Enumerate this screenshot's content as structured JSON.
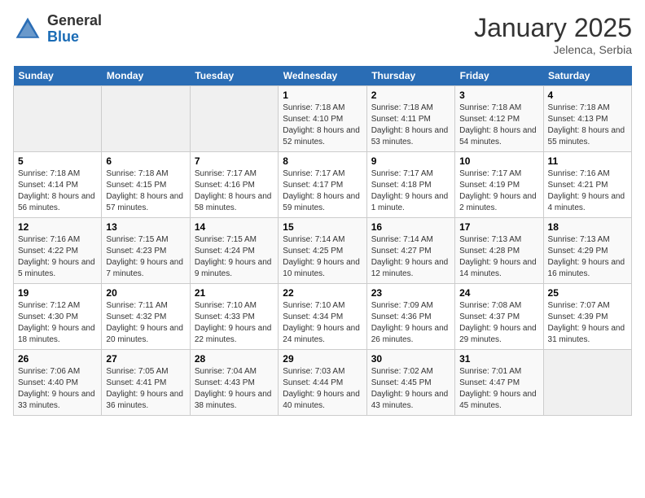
{
  "header": {
    "logo_general": "General",
    "logo_blue": "Blue",
    "month_title": "January 2025",
    "location": "Jelenca, Serbia"
  },
  "weekdays": [
    "Sunday",
    "Monday",
    "Tuesday",
    "Wednesday",
    "Thursday",
    "Friday",
    "Saturday"
  ],
  "rows": [
    [
      {
        "day": "",
        "sunrise": "",
        "sunset": "",
        "daylight": "",
        "empty": true
      },
      {
        "day": "",
        "sunrise": "",
        "sunset": "",
        "daylight": "",
        "empty": true
      },
      {
        "day": "",
        "sunrise": "",
        "sunset": "",
        "daylight": "",
        "empty": true
      },
      {
        "day": "1",
        "sunrise": "Sunrise: 7:18 AM",
        "sunset": "Sunset: 4:10 PM",
        "daylight": "Daylight: 8 hours and 52 minutes."
      },
      {
        "day": "2",
        "sunrise": "Sunrise: 7:18 AM",
        "sunset": "Sunset: 4:11 PM",
        "daylight": "Daylight: 8 hours and 53 minutes."
      },
      {
        "day": "3",
        "sunrise": "Sunrise: 7:18 AM",
        "sunset": "Sunset: 4:12 PM",
        "daylight": "Daylight: 8 hours and 54 minutes."
      },
      {
        "day": "4",
        "sunrise": "Sunrise: 7:18 AM",
        "sunset": "Sunset: 4:13 PM",
        "daylight": "Daylight: 8 hours and 55 minutes."
      }
    ],
    [
      {
        "day": "5",
        "sunrise": "Sunrise: 7:18 AM",
        "sunset": "Sunset: 4:14 PM",
        "daylight": "Daylight: 8 hours and 56 minutes."
      },
      {
        "day": "6",
        "sunrise": "Sunrise: 7:18 AM",
        "sunset": "Sunset: 4:15 PM",
        "daylight": "Daylight: 8 hours and 57 minutes."
      },
      {
        "day": "7",
        "sunrise": "Sunrise: 7:17 AM",
        "sunset": "Sunset: 4:16 PM",
        "daylight": "Daylight: 8 hours and 58 minutes."
      },
      {
        "day": "8",
        "sunrise": "Sunrise: 7:17 AM",
        "sunset": "Sunset: 4:17 PM",
        "daylight": "Daylight: 8 hours and 59 minutes."
      },
      {
        "day": "9",
        "sunrise": "Sunrise: 7:17 AM",
        "sunset": "Sunset: 4:18 PM",
        "daylight": "Daylight: 9 hours and 1 minute."
      },
      {
        "day": "10",
        "sunrise": "Sunrise: 7:17 AM",
        "sunset": "Sunset: 4:19 PM",
        "daylight": "Daylight: 9 hours and 2 minutes."
      },
      {
        "day": "11",
        "sunrise": "Sunrise: 7:16 AM",
        "sunset": "Sunset: 4:21 PM",
        "daylight": "Daylight: 9 hours and 4 minutes."
      }
    ],
    [
      {
        "day": "12",
        "sunrise": "Sunrise: 7:16 AM",
        "sunset": "Sunset: 4:22 PM",
        "daylight": "Daylight: 9 hours and 5 minutes."
      },
      {
        "day": "13",
        "sunrise": "Sunrise: 7:15 AM",
        "sunset": "Sunset: 4:23 PM",
        "daylight": "Daylight: 9 hours and 7 minutes."
      },
      {
        "day": "14",
        "sunrise": "Sunrise: 7:15 AM",
        "sunset": "Sunset: 4:24 PM",
        "daylight": "Daylight: 9 hours and 9 minutes."
      },
      {
        "day": "15",
        "sunrise": "Sunrise: 7:14 AM",
        "sunset": "Sunset: 4:25 PM",
        "daylight": "Daylight: 9 hours and 10 minutes."
      },
      {
        "day": "16",
        "sunrise": "Sunrise: 7:14 AM",
        "sunset": "Sunset: 4:27 PM",
        "daylight": "Daylight: 9 hours and 12 minutes."
      },
      {
        "day": "17",
        "sunrise": "Sunrise: 7:13 AM",
        "sunset": "Sunset: 4:28 PM",
        "daylight": "Daylight: 9 hours and 14 minutes."
      },
      {
        "day": "18",
        "sunrise": "Sunrise: 7:13 AM",
        "sunset": "Sunset: 4:29 PM",
        "daylight": "Daylight: 9 hours and 16 minutes."
      }
    ],
    [
      {
        "day": "19",
        "sunrise": "Sunrise: 7:12 AM",
        "sunset": "Sunset: 4:30 PM",
        "daylight": "Daylight: 9 hours and 18 minutes."
      },
      {
        "day": "20",
        "sunrise": "Sunrise: 7:11 AM",
        "sunset": "Sunset: 4:32 PM",
        "daylight": "Daylight: 9 hours and 20 minutes."
      },
      {
        "day": "21",
        "sunrise": "Sunrise: 7:10 AM",
        "sunset": "Sunset: 4:33 PM",
        "daylight": "Daylight: 9 hours and 22 minutes."
      },
      {
        "day": "22",
        "sunrise": "Sunrise: 7:10 AM",
        "sunset": "Sunset: 4:34 PM",
        "daylight": "Daylight: 9 hours and 24 minutes."
      },
      {
        "day": "23",
        "sunrise": "Sunrise: 7:09 AM",
        "sunset": "Sunset: 4:36 PM",
        "daylight": "Daylight: 9 hours and 26 minutes."
      },
      {
        "day": "24",
        "sunrise": "Sunrise: 7:08 AM",
        "sunset": "Sunset: 4:37 PM",
        "daylight": "Daylight: 9 hours and 29 minutes."
      },
      {
        "day": "25",
        "sunrise": "Sunrise: 7:07 AM",
        "sunset": "Sunset: 4:39 PM",
        "daylight": "Daylight: 9 hours and 31 minutes."
      }
    ],
    [
      {
        "day": "26",
        "sunrise": "Sunrise: 7:06 AM",
        "sunset": "Sunset: 4:40 PM",
        "daylight": "Daylight: 9 hours and 33 minutes."
      },
      {
        "day": "27",
        "sunrise": "Sunrise: 7:05 AM",
        "sunset": "Sunset: 4:41 PM",
        "daylight": "Daylight: 9 hours and 36 minutes."
      },
      {
        "day": "28",
        "sunrise": "Sunrise: 7:04 AM",
        "sunset": "Sunset: 4:43 PM",
        "daylight": "Daylight: 9 hours and 38 minutes."
      },
      {
        "day": "29",
        "sunrise": "Sunrise: 7:03 AM",
        "sunset": "Sunset: 4:44 PM",
        "daylight": "Daylight: 9 hours and 40 minutes."
      },
      {
        "day": "30",
        "sunrise": "Sunrise: 7:02 AM",
        "sunset": "Sunset: 4:45 PM",
        "daylight": "Daylight: 9 hours and 43 minutes."
      },
      {
        "day": "31",
        "sunrise": "Sunrise: 7:01 AM",
        "sunset": "Sunset: 4:47 PM",
        "daylight": "Daylight: 9 hours and 45 minutes."
      },
      {
        "day": "",
        "sunrise": "",
        "sunset": "",
        "daylight": "",
        "empty": true
      }
    ]
  ]
}
